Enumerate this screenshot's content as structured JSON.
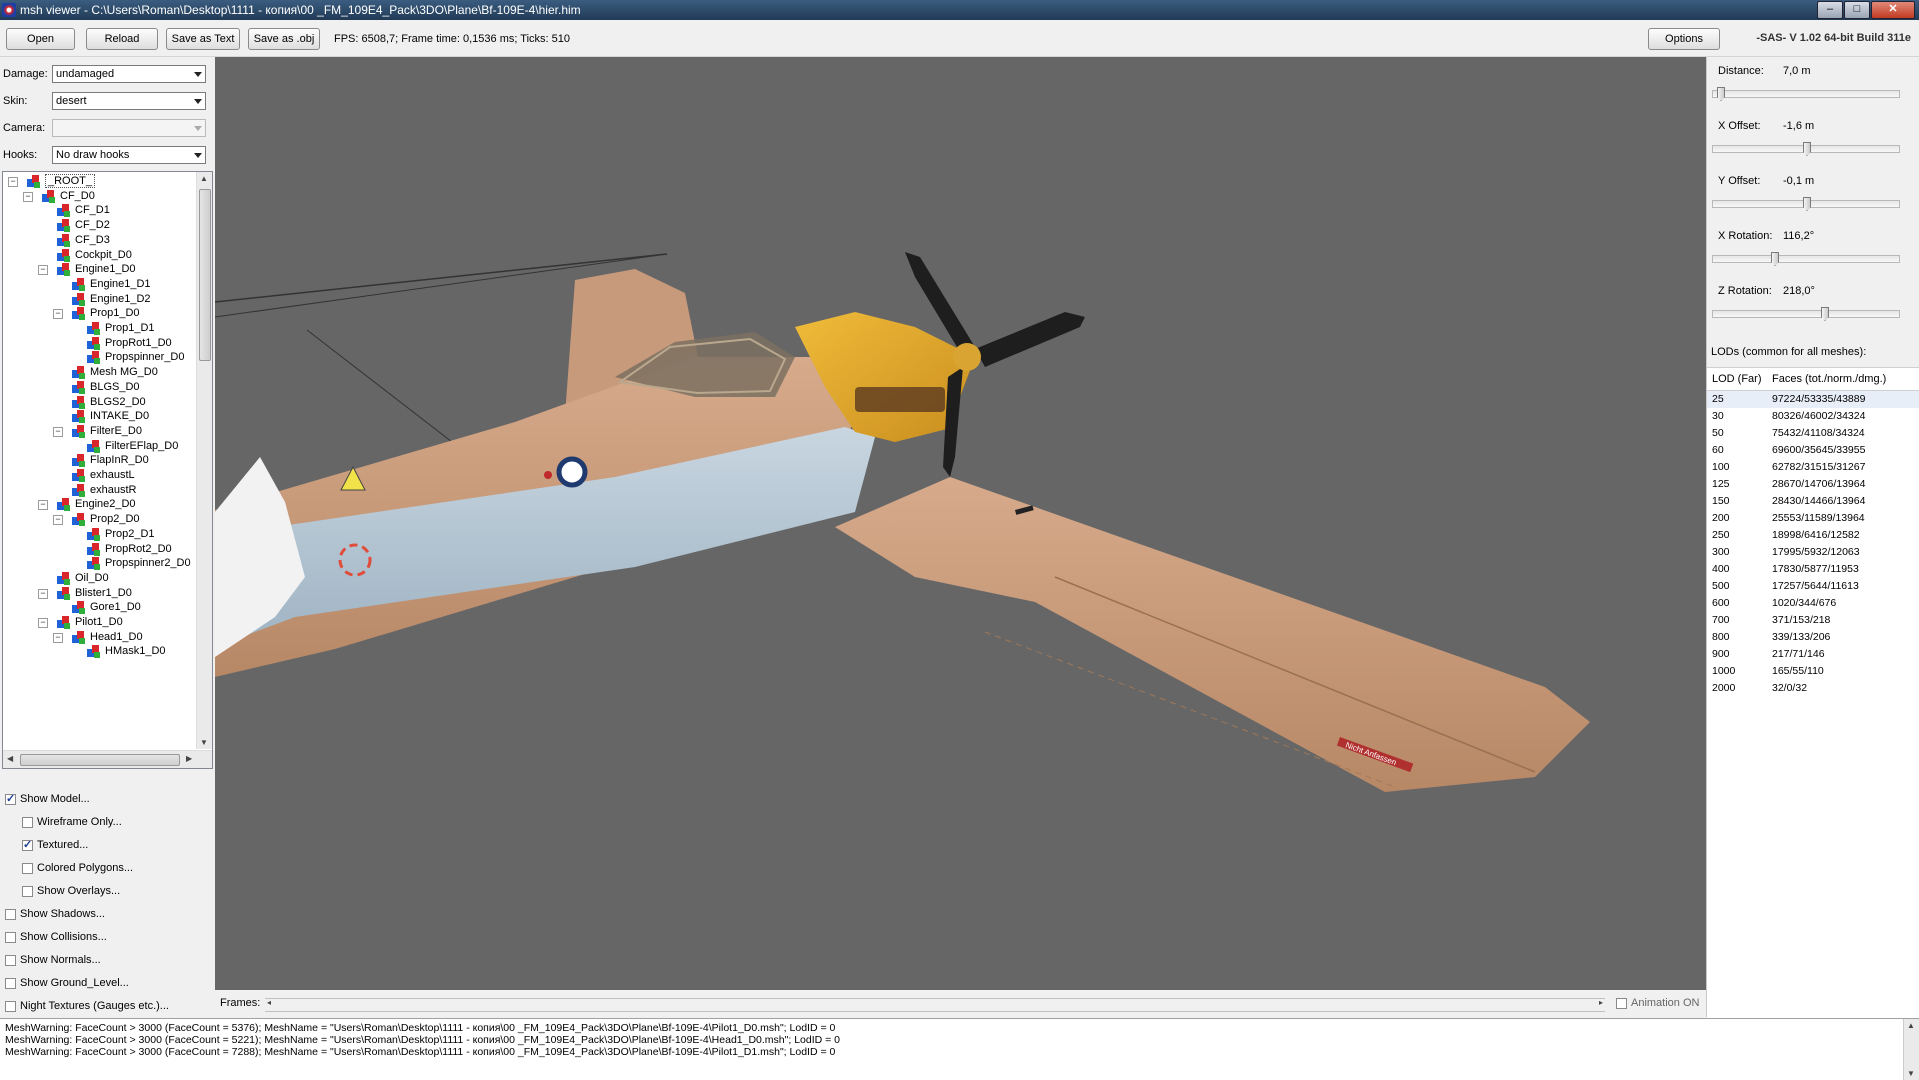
{
  "window": {
    "title": "msh viewer - C:\\Users\\Roman\\Desktop\\1111 - копия\\00 _FM_109E4_Pack\\3DO\\Plane\\Bf-109E-4\\hier.him",
    "min": "–",
    "max": "□",
    "close": "✕"
  },
  "toolbar": {
    "open": "Open",
    "reload": "Reload",
    "save_text": "Save as Text",
    "save_obj": "Save as .obj",
    "fps": "FPS: 6508,7; Frame time: 0,1536 ms; Ticks: 510",
    "options": "Options",
    "build": "-SAS- V 1.02  64-bit  Build 311e"
  },
  "left": {
    "damage_label": "Damage:",
    "damage_value": "undamaged",
    "skin_label": "Skin:",
    "skin_value": "desert",
    "camera_label": "Camera:",
    "camera_value": "",
    "hooks_label": "Hooks:",
    "hooks_value": "No draw hooks"
  },
  "tree": [
    {
      "label": "_ROOT_",
      "level": 0,
      "toggle": "−",
      "root": true
    },
    {
      "label": "CF_D0",
      "level": 1,
      "toggle": "−"
    },
    {
      "label": "CF_D1",
      "level": 2
    },
    {
      "label": "CF_D2",
      "level": 2
    },
    {
      "label": "CF_D3",
      "level": 2
    },
    {
      "label": "Cockpit_D0",
      "level": 2
    },
    {
      "label": "Engine1_D0",
      "level": 2,
      "toggle": "−"
    },
    {
      "label": "Engine1_D1",
      "level": 3
    },
    {
      "label": "Engine1_D2",
      "level": 3
    },
    {
      "label": "Prop1_D0",
      "level": 3,
      "toggle": "−"
    },
    {
      "label": "Prop1_D1",
      "level": 4
    },
    {
      "label": "PropRot1_D0",
      "level": 4
    },
    {
      "label": "Propspinner_D0",
      "level": 4
    },
    {
      "label": "Mesh MG_D0",
      "level": 3
    },
    {
      "label": "BLGS_D0",
      "level": 3
    },
    {
      "label": "BLGS2_D0",
      "level": 3
    },
    {
      "label": "INTAKE_D0",
      "level": 3
    },
    {
      "label": "FilterE_D0",
      "level": 3,
      "toggle": "−"
    },
    {
      "label": "FilterEFlap_D0",
      "level": 4
    },
    {
      "label": "FlapInR_D0",
      "level": 3
    },
    {
      "label": "exhaustL",
      "level": 3
    },
    {
      "label": "exhaustR",
      "level": 3
    },
    {
      "label": "Engine2_D0",
      "level": 2,
      "toggle": "−"
    },
    {
      "label": "Prop2_D0",
      "level": 3,
      "toggle": "−"
    },
    {
      "label": "Prop2_D1",
      "level": 4
    },
    {
      "label": "PropRot2_D0",
      "level": 4
    },
    {
      "label": "Propspinner2_D0",
      "level": 4
    },
    {
      "label": "Oil_D0",
      "level": 2
    },
    {
      "label": "Blister1_D0",
      "level": 2,
      "toggle": "−"
    },
    {
      "label": "Gore1_D0",
      "level": 3
    },
    {
      "label": "Pilot1_D0",
      "level": 2,
      "toggle": "−"
    },
    {
      "label": "Head1_D0",
      "level": 3,
      "toggle": "−"
    },
    {
      "label": "HMask1_D0",
      "level": 4
    }
  ],
  "checks": [
    {
      "label": "Show Model...",
      "checked": true,
      "indent": 0
    },
    {
      "label": "Wireframe Only...",
      "checked": false,
      "indent": 1
    },
    {
      "label": "Textured...",
      "checked": true,
      "indent": 1
    },
    {
      "label": "Colored Polygons...",
      "checked": false,
      "indent": 1
    },
    {
      "label": "Show Overlays...",
      "checked": false,
      "indent": 1
    },
    {
      "label": "Show Shadows...",
      "checked": false,
      "indent": 0
    },
    {
      "label": "Show Collisions...",
      "checked": false,
      "indent": 0
    },
    {
      "label": "Show Normals...",
      "checked": false,
      "indent": 0
    },
    {
      "label": "Show Ground_Level...",
      "checked": false,
      "indent": 0
    },
    {
      "label": "Night Textures (Gauges etc.)...",
      "checked": false,
      "indent": 0
    }
  ],
  "frames": {
    "label": "Frames:",
    "anim": "Animation ON",
    "left_arrow": "◂",
    "right_arrow": "▸"
  },
  "log": [
    "MeshWarning: FaceCount > 3000 (FaceCount = 5376); MeshName = \"Users\\Roman\\Desktop\\1111 - копия\\00 _FM_109E4_Pack\\3DO\\Plane\\Bf-109E-4\\Pilot1_D0.msh\"; LodID = 0",
    "MeshWarning: FaceCount > 3000 (FaceCount = 5221); MeshName = \"Users\\Roman\\Desktop\\1111 - копия\\00 _FM_109E4_Pack\\3DO\\Plane\\Bf-109E-4\\Head1_D0.msh\"; LodID = 0",
    "MeshWarning: FaceCount > 3000 (FaceCount = 7288); MeshName = \"Users\\Roman\\Desktop\\1111 - копия\\00 _FM_109E4_Pack\\3DO\\Plane\\Bf-109E-4\\Pilot1_D1.msh\"; LodID = 0"
  ],
  "right": {
    "sliders": [
      {
        "name": "Distance:",
        "value": "7,0 m",
        "pos": 0.02
      },
      {
        "name": "X Offset:",
        "value": "-1,6 m",
        "pos": 0.5
      },
      {
        "name": "Y Offset:",
        "value": "-0,1 m",
        "pos": 0.5
      },
      {
        "name": "X Rotation:",
        "value": "116,2°",
        "pos": 0.32
      },
      {
        "name": "Z Rotation:",
        "value": "218,0°",
        "pos": 0.6
      }
    ],
    "lods_title": "LODs (common for all meshes):",
    "lod_header": [
      "LOD (Far)",
      "Faces (tot./norm./dmg.)"
    ],
    "lods": [
      [
        "25",
        "97224/53335/43889"
      ],
      [
        "30",
        "80326/46002/34324"
      ],
      [
        "50",
        "75432/41108/34324"
      ],
      [
        "60",
        "69600/35645/33955"
      ],
      [
        "100",
        "62782/31515/31267"
      ],
      [
        "125",
        "28670/14706/13964"
      ],
      [
        "150",
        "28430/14466/13964"
      ],
      [
        "200",
        "25553/11589/13964"
      ],
      [
        "250",
        "18998/6416/12582"
      ],
      [
        "300",
        "17995/5932/12063"
      ],
      [
        "400",
        "17830/5877/11953"
      ],
      [
        "500",
        "17257/5644/11613"
      ],
      [
        "600",
        "1020/344/676"
      ],
      [
        "700",
        "371/153/218"
      ],
      [
        "800",
        "339/133/206"
      ],
      [
        "900",
        "217/71/146"
      ],
      [
        "1000",
        "165/55/110"
      ],
      [
        "2000",
        "32/0/32"
      ]
    ]
  },
  "plane_marking": "Nicht Anfassen",
  "colors": {
    "viewport_bg": "#666666",
    "fuselage_tan": "#c7987a",
    "fuselage_blue": "#b9cad6",
    "nose_yellow": "#e3aa2c",
    "prop_black": "#1e1e1e",
    "selection": "#3399ff"
  }
}
